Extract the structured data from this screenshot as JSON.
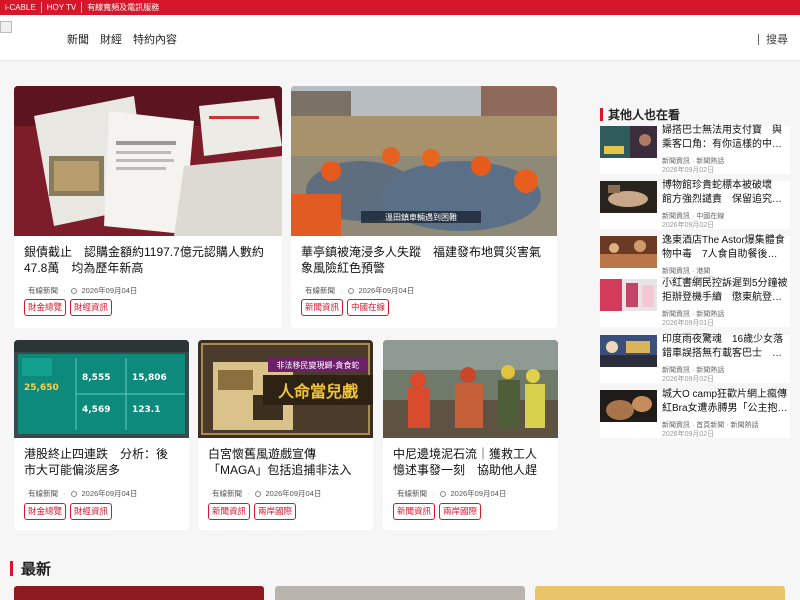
{
  "topbar": {
    "items": [
      "i-CABLE",
      "HOY TV",
      "有線寬頻及電訊服務"
    ]
  },
  "nav": {
    "items": [
      "新聞",
      "財經",
      "特約內容"
    ],
    "search_label": "搜尋"
  },
  "featured": [
    {
      "title": "銀債截止　認購金額約1197.7億元認購人數約47.8萬　均為歷年新高",
      "source": "有線新聞",
      "date": "2026年09月04日",
      "tags": [
        "財金總覽",
        "財經資訊"
      ]
    },
    {
      "title": "華亭鎮被淹浸多人失蹤　福建發布地質災害氣象風險紅色預警",
      "source": "有線新聞",
      "date": "2026年09月04日",
      "tags": [
        "新聞資訊",
        "中國在線"
      ],
      "caption": "溫田鎮車輛遇到困難"
    },
    {
      "title": "港股終止四連跌　分析：後市大可能偏淡居多",
      "source": "有線新聞",
      "date": "2026年09月04日",
      "tags": [
        "財金總覽",
        "財經資訊"
      ],
      "screen_values": [
        "25,650",
        "8,555",
        "15,806",
        "4,569",
        "123.1"
      ]
    },
    {
      "title": "白宮懷舊風遊戲宣傳「MAGA」包括追捕非法入境者　人權組織：…",
      "source": "有線新聞",
      "date": "2026年09月04日",
      "tags": [
        "新聞資訊",
        "兩岸國際"
      ],
      "banner_lines": [
        "非法移民變現歸-貪食蛇",
        "人命當兒戲"
      ]
    },
    {
      "title": "中尼邊境泥石流｜獲救工人憶述事發一刻　協助他人趕不及撤離　仍…",
      "source": "有線新聞",
      "date": "2026年09月04日",
      "tags": [
        "新聞資訊",
        "兩岸國際"
      ]
    }
  ],
  "sidebar": {
    "heading": "其他人也在看",
    "items": [
      {
        "title": "婦搭巴士無法用支付寶　與乘客口角：有你這樣的中…",
        "meta": "新聞資訊 · 新聞熱話",
        "date": "2026年09月02日"
      },
      {
        "title": "博物館珍貴蛇標本被破壞　館方強烈譴責　保留追究…",
        "meta": "新聞資訊 · 中國在線",
        "date": "2026年09月02日"
      },
      {
        "title": "逸東酒店The Astor爆集體食物中毒　7人食自助餐後…",
        "meta": "新聞資訊 · 港聞",
        "date": "2026年09月03日"
      },
      {
        "title": "小紅書網民控訴遲到5分鐘被拒辦登機手續　懲東航登…",
        "meta": "新聞資訊 · 新聞熱話",
        "date": "2026年09月01日"
      },
      {
        "title": "印度雨夜驚魂　16歲少女落錯車誤搭無冇載客巴士　…",
        "meta": "新聞資訊 · 新聞熱話",
        "date": "2026年09月02日"
      },
      {
        "title": "城大O camp狂歡片網上瘋傳　紅Bra女遭赤膊男「公主抱…",
        "meta": "新聞資訊 · 首頁新聞 · 新聞熱話",
        "date": "2026年09月02日"
      }
    ]
  },
  "latest": {
    "heading": "最新"
  },
  "colors": {
    "accent": "#d7162a"
  }
}
